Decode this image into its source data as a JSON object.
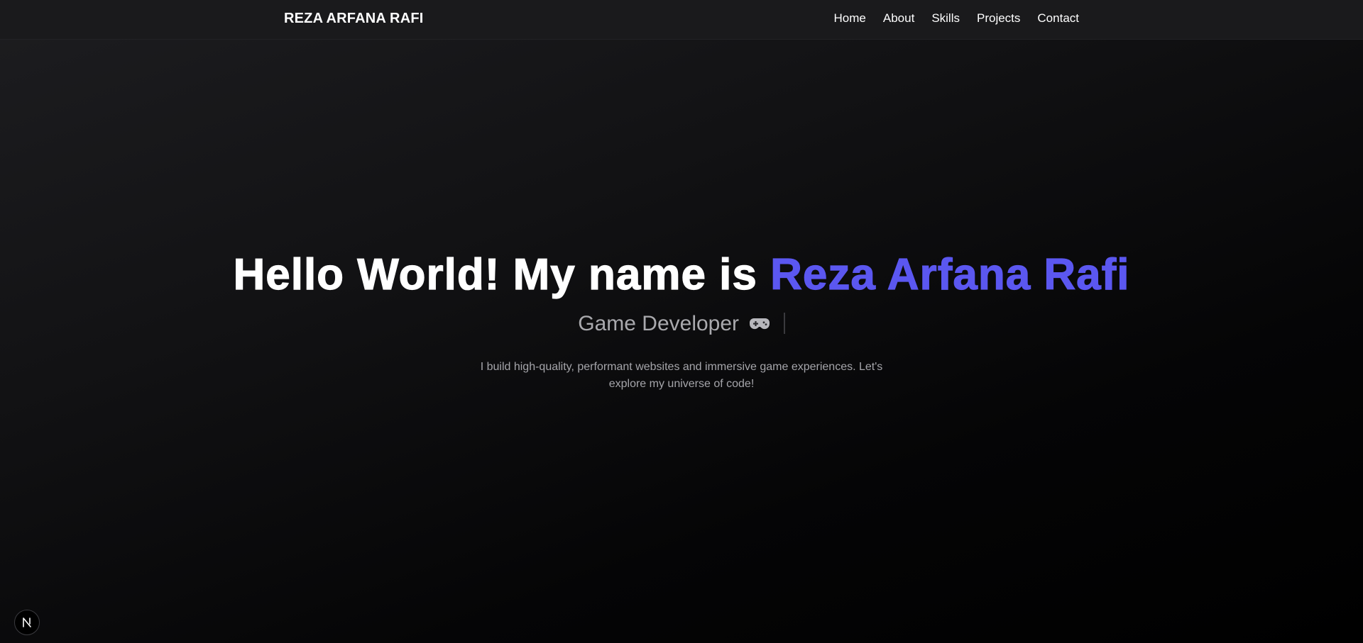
{
  "header": {
    "brand": "REZA ARFANA RAFI",
    "nav": [
      {
        "label": "Home"
      },
      {
        "label": "About"
      },
      {
        "label": "Skills"
      },
      {
        "label": "Projects"
      },
      {
        "label": "Contact"
      }
    ]
  },
  "hero": {
    "greeting": "Hello World! My name is ",
    "name": "Reza Arfana Rafi",
    "role": "Game Developer",
    "role_icon": "gamepad-icon",
    "description": "I build high-quality, performant websites and immersive game experiences. Let's explore my universe of code!"
  },
  "badge": {
    "icon": "nextjs-logo-icon",
    "letter": "N"
  },
  "colors": {
    "accent": "#5b57f0",
    "background": "#000000",
    "navbar": "#1a1a1c",
    "muted_text": "#a9a9ad"
  }
}
